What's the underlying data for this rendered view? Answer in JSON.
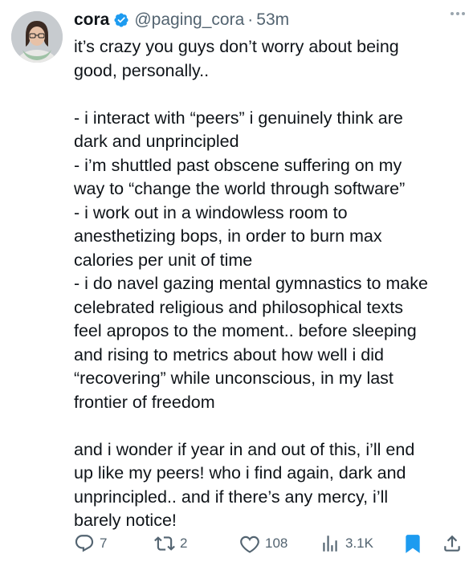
{
  "author": {
    "name": "cora",
    "handle": "@paging_cora",
    "separator": "·",
    "time": "53m",
    "verified_icon": "verified-badge-icon",
    "avatar_icon": "avatar-photo"
  },
  "tweet": {
    "lines": [
      "it’s crazy you guys don’t worry about being",
      "good, personally..",
      "",
      "- i interact with “peers” i genuinely think are",
      "dark and unprincipled",
      "- i’m shuttled past obscene suffering on my",
      "way to “change the world through software”",
      "- i work out in a windowless room to",
      "anesthetizing bops, in order to burn max",
      "calories per unit of time",
      "- i do navel gazing mental gymnastics to make",
      "celebrated religious and philosophical texts",
      "feel apropos to the moment.. before sleeping",
      "and rising to metrics about how well i did",
      "“recovering” while unconscious, in my last",
      "frontier of freedom",
      "",
      "and i wonder if year in and out of this, i’ll end",
      "up like my peers! who i find again, dark and",
      "unprincipled.. and if there’s any mercy, i’ll",
      "barely notice!"
    ]
  },
  "actions": {
    "replies": "7",
    "reposts": "2",
    "likes": "108",
    "views": "3.1K"
  },
  "colors": {
    "text": "#0f1419",
    "secondary": "#536471",
    "accent": "#1d9bf0"
  }
}
